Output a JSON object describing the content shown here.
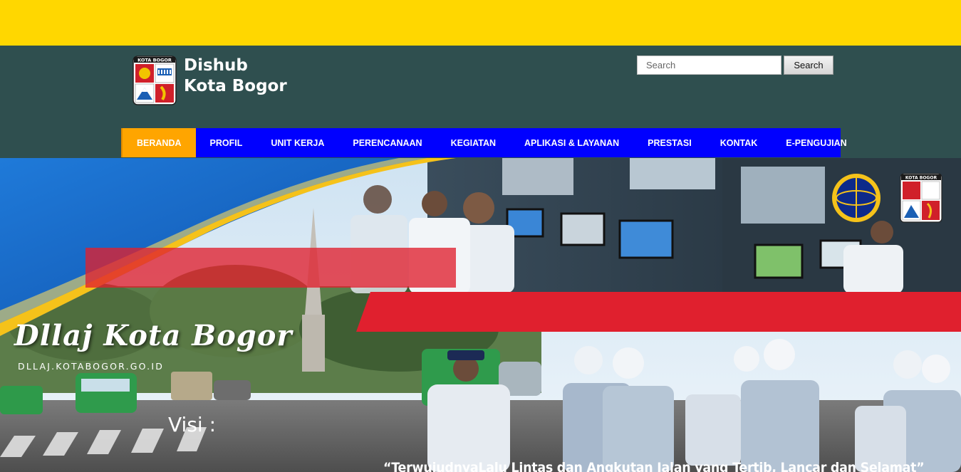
{
  "header": {
    "title_line1": "Dishub",
    "title_line2": "Kota Bogor",
    "logo_text": "KOTA BOGOR"
  },
  "search": {
    "placeholder": "Search",
    "button_label": "Search"
  },
  "nav": {
    "items": [
      {
        "label": "BERANDA"
      },
      {
        "label": "PROFIL"
      },
      {
        "label": "UNIT KERJA"
      },
      {
        "label": "PERENCANAAN"
      },
      {
        "label": "KEGIATAN"
      },
      {
        "label": "APLIKASI & LAYANAN"
      },
      {
        "label": "PRESTASI"
      },
      {
        "label": "KONTAK"
      },
      {
        "label": "E-PENGUJIAN"
      }
    ],
    "active_label": "BERANDA"
  },
  "banner": {
    "title": "Dllaj Kota Bogor",
    "url": "DLLAJ.KOTABOGOR.GO.ID",
    "visi_label": "Visi :",
    "visi_text": "“TerwujudnyaLalu Lintas dan Angkutan Jalan yang Tertib, Lancar dan Selamat”",
    "emblem_text": "KOTA BOGOR"
  },
  "colors": {
    "top_strip": "#FFD700",
    "header_bg": "#2F4F4F",
    "nav_bg": "#0000FF",
    "nav_active": "#FFA500",
    "banner_red": "#E0202E",
    "banner_blue": "#1E6FD0"
  }
}
